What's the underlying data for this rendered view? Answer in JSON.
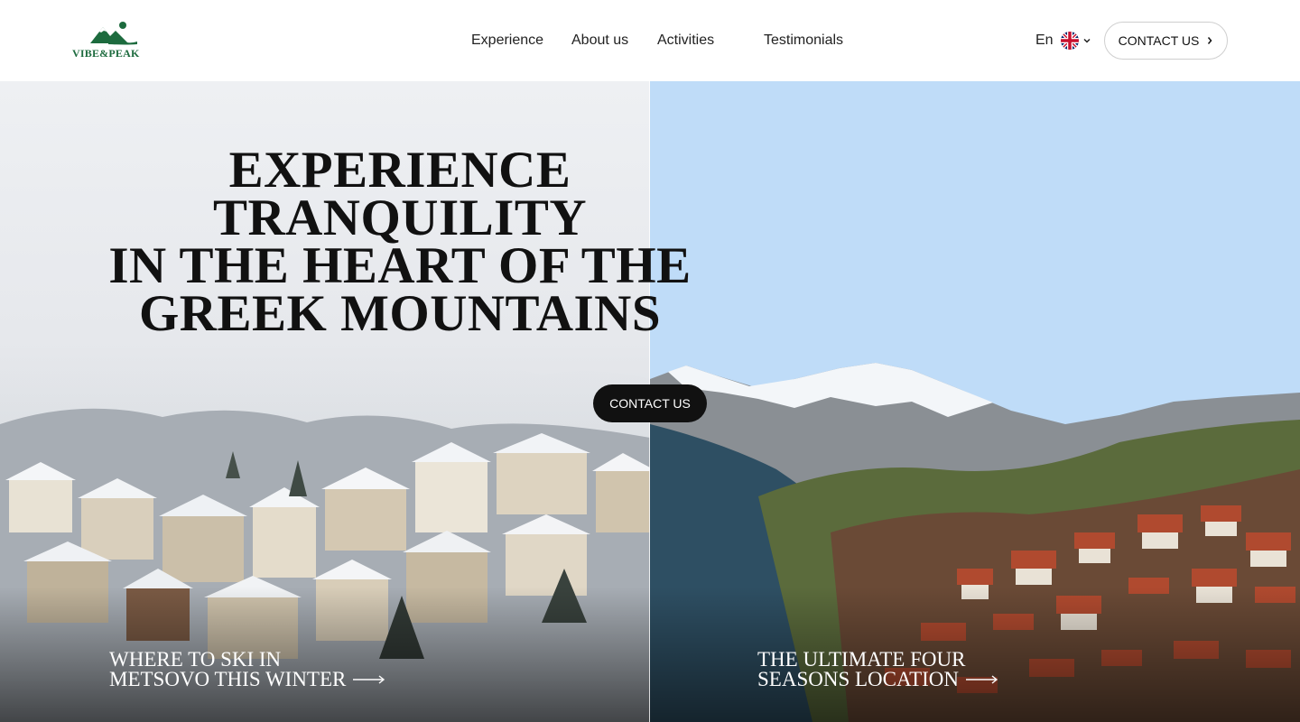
{
  "brand": {
    "name": "VIBE&PEAK",
    "color": "#1d6b3e"
  },
  "nav": {
    "items": [
      {
        "label": "Experience"
      },
      {
        "label": "About us"
      },
      {
        "label": "Activities"
      },
      {
        "label": "Testimonials"
      }
    ]
  },
  "language": {
    "label": "En",
    "flag": "uk-flag-icon"
  },
  "header_cta": {
    "label": "CONTACT US"
  },
  "hero": {
    "title_lines": [
      "EXPERIENCE TRANQUILITY",
      "IN THE HEART OF THE",
      "GREEK MOUNTAINS"
    ],
    "cta": {
      "label": "CONTACT US"
    },
    "cards": [
      {
        "line1": "WHERE TO SKI IN",
        "line2": "METSOVO THIS WINTER"
      },
      {
        "line1": "THE ULTIMATE FOUR",
        "line2": "SEASONS LOCATION"
      }
    ]
  },
  "colors": {
    "accent": "#1d6b3e",
    "dark_button": "#111111",
    "sky": "#bfdcf8"
  }
}
